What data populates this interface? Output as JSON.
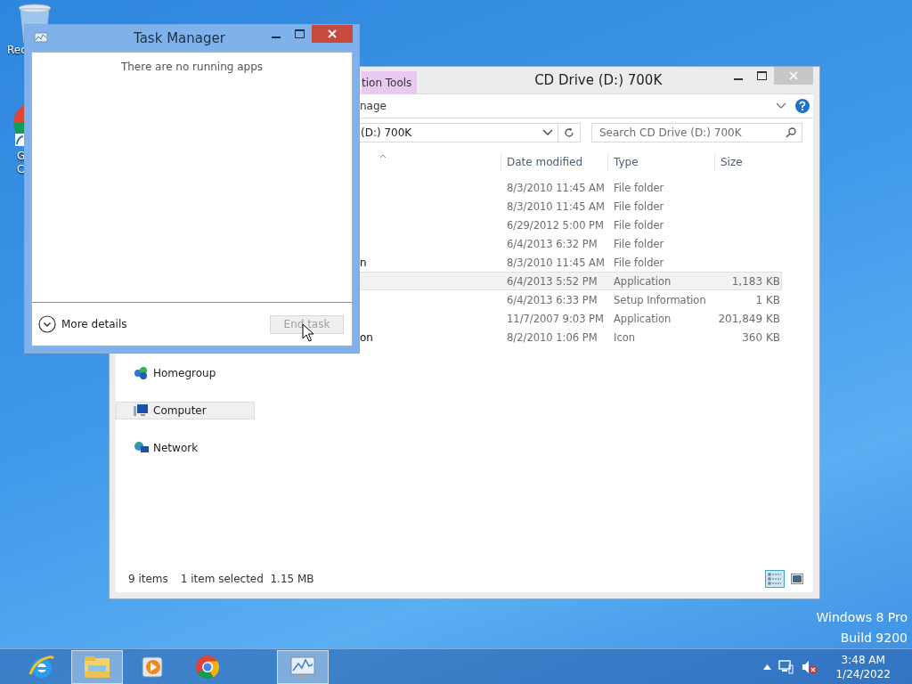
{
  "desktop_icons": [
    {
      "kind": "recycle-bin",
      "lines": [
        "Rec"
      ]
    },
    {
      "kind": "chrome-shortcut",
      "lines": [
        "G",
        "C"
      ]
    }
  ],
  "explorer": {
    "title": "CD Drive (D:) 700K",
    "context_tab": "tion Tools",
    "ribbon_tab": "nage",
    "address": "(D:) 700K",
    "search": {
      "placeholder": "Search CD Drive (D:) 700K"
    },
    "columns": [
      "Date modified",
      "Type",
      "Size"
    ],
    "rows": [
      {
        "date": "8/3/2010 11:45 AM",
        "type": "File folder",
        "selected": false
      },
      {
        "date": "8/3/2010 11:45 AM",
        "type": "File folder",
        "selected": false
      },
      {
        "date": "6/29/2012 5:00 PM",
        "type": "File folder",
        "selected": false
      },
      {
        "date": "6/4/2013 6:32 PM",
        "type": "File folder",
        "selected": false
      },
      {
        "name": "n",
        "date": "8/3/2010 11:45 AM",
        "type": "File folder",
        "selected": false
      },
      {
        "date": "6/4/2013 5:52 PM",
        "type": "Application",
        "size": "1,183 KB",
        "selected": true
      },
      {
        "date": "6/4/2013 6:33 PM",
        "type": "Setup Information",
        "size": "1 KB",
        "selected": false
      },
      {
        "date": "11/7/2007 9:03 PM",
        "type": "Application",
        "size": "201,849 KB",
        "selected": false
      },
      {
        "name": "on",
        "date": "8/2/2010 1:06 PM",
        "type": "Icon",
        "size": "360 KB",
        "selected": false
      }
    ],
    "nav": [
      {
        "kind": "homegroup",
        "label": "Homegroup",
        "selected": false
      },
      {
        "kind": "computer",
        "label": "Computer",
        "selected": true
      },
      {
        "kind": "network",
        "label": "Network",
        "selected": false
      }
    ],
    "status": {
      "count": "9 items",
      "selection": "1 item selected  1.15 MB"
    },
    "views": [
      {
        "kind": "details",
        "selected": true
      },
      {
        "kind": "large-icons",
        "selected": false
      }
    ]
  },
  "task_manager": {
    "title": "Task Manager",
    "message": "There are no running apps",
    "more_details": "More details",
    "end_task": {
      "label": "End task",
      "disabled": true
    }
  },
  "edition": [
    "Windows 8 Pro",
    "Build 9200"
  ],
  "taskbar": {
    "apps": [
      {
        "kind": "ie",
        "active": false
      },
      {
        "kind": "explorer",
        "active": true
      },
      {
        "kind": "media",
        "active": false
      },
      {
        "kind": "chrome",
        "active": false
      },
      {
        "kind": "task-manager",
        "active": true
      }
    ],
    "time": "3:48 AM",
    "date": "1/24/2022"
  }
}
